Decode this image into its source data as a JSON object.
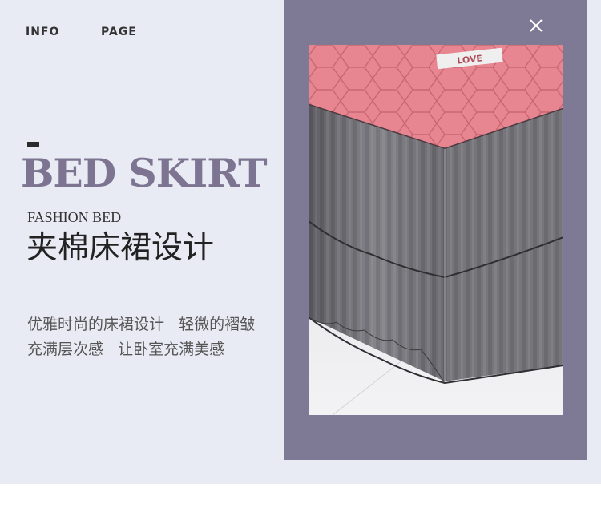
{
  "nav": {
    "items": [
      {
        "label": "INFO"
      },
      {
        "label": "PAGE"
      }
    ]
  },
  "hero": {
    "headline": "BED SKIRT",
    "subhead": "FASHION BED",
    "title_cn": "夹棉床裙设计",
    "description_lines": [
      "优雅时尚的床裙设计   轻微的褶皱",
      "充满层次感   让卧室充满美感"
    ]
  },
  "photo": {
    "label_text": "LOVE",
    "icon": "product-photo"
  },
  "close": {
    "icon": "close-icon"
  },
  "colors": {
    "page_background": "#e9ebf4",
    "frame": "#7e7a95",
    "headline": "#7d7491",
    "quilt_pink": "#e78590",
    "skirt_gray": "#77777d"
  }
}
